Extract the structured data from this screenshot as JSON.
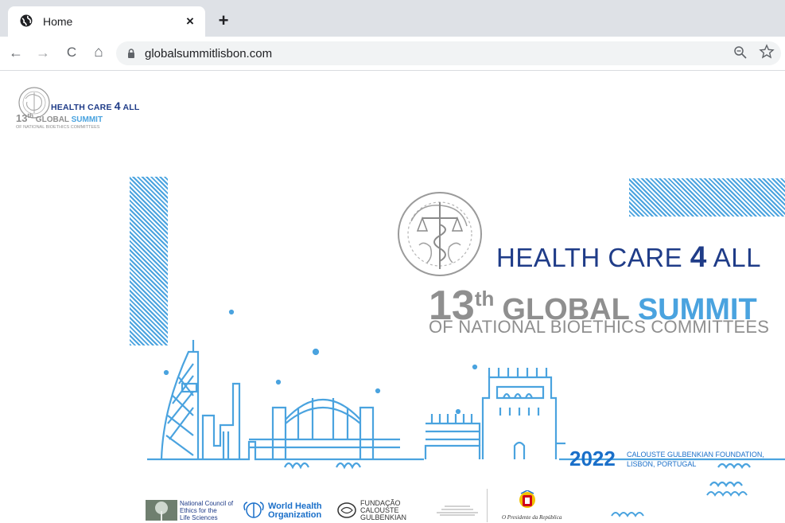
{
  "browser": {
    "tab_title": "Home",
    "tab_close": "×",
    "new_tab": "+",
    "back": "←",
    "forward": "→",
    "reload": "C",
    "home": "⌂",
    "url": "globalsummitlisbon.com",
    "zoom_icon": "zoom-icon",
    "star_icon": "star-icon"
  },
  "site_logo": {
    "line1_a": "HEALTH CARE ",
    "line1_b": "4",
    "line1_c": " ALL",
    "line2_a": "13",
    "line2_b": "th",
    "line2_c": " GLOBAL ",
    "line2_d": "SUMMIT",
    "line3": "OF NATIONAL BIOETHICS COMMITTEES"
  },
  "banner": {
    "headline_a": "HEALTH CARE ",
    "headline_b": "4",
    "headline_c": " ALL",
    "summit_num": "13",
    "summit_th": "th",
    "summit_global": "GLOBAL",
    "summit_word": "SUMMIT",
    "subtitle": "OF NATIONAL BIOETHICS COMMITTEES",
    "year": "2022",
    "venue_line1": "CALOUSTE GULBENKIAN FOUNDATION,",
    "venue_line2": "LISBON, PORTUGAL"
  },
  "sponsors": {
    "ncels_1": "National Council of",
    "ncels_2": "Ethics for the",
    "ncels_3": "Life Sciences",
    "who_1": "World Health",
    "who_2": "Organization",
    "gulb_1": "FUNDAÇÃO",
    "gulb_2": "CALOUSTE",
    "gulb_3": "GULBENKIAN",
    "presidente": "O Presidente da República"
  },
  "colors": {
    "brand_navy": "#1f3c88",
    "brand_blue": "#4aa3df",
    "grey": "#8f8f8f"
  }
}
